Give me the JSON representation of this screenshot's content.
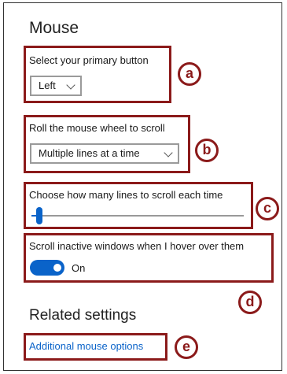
{
  "page": {
    "title": "Mouse",
    "related_heading": "Related settings"
  },
  "primary_button": {
    "label": "Select your primary button",
    "value": "Left",
    "marker": "a"
  },
  "scroll_mode": {
    "label": "Roll the mouse wheel to scroll",
    "value": "Multiple lines at a time",
    "marker": "b"
  },
  "scroll_lines": {
    "label": "Choose how many lines to scroll each time",
    "value_fraction": 0.03,
    "marker": "c"
  },
  "inactive_scroll": {
    "label": "Scroll inactive windows when I hover over them",
    "state_label": "On",
    "is_on": true,
    "marker": "d"
  },
  "additional": {
    "link_text": "Additional mouse options",
    "marker": "e"
  },
  "colors": {
    "accent": "#0a63c9",
    "annotation": "#8b1a1a"
  }
}
